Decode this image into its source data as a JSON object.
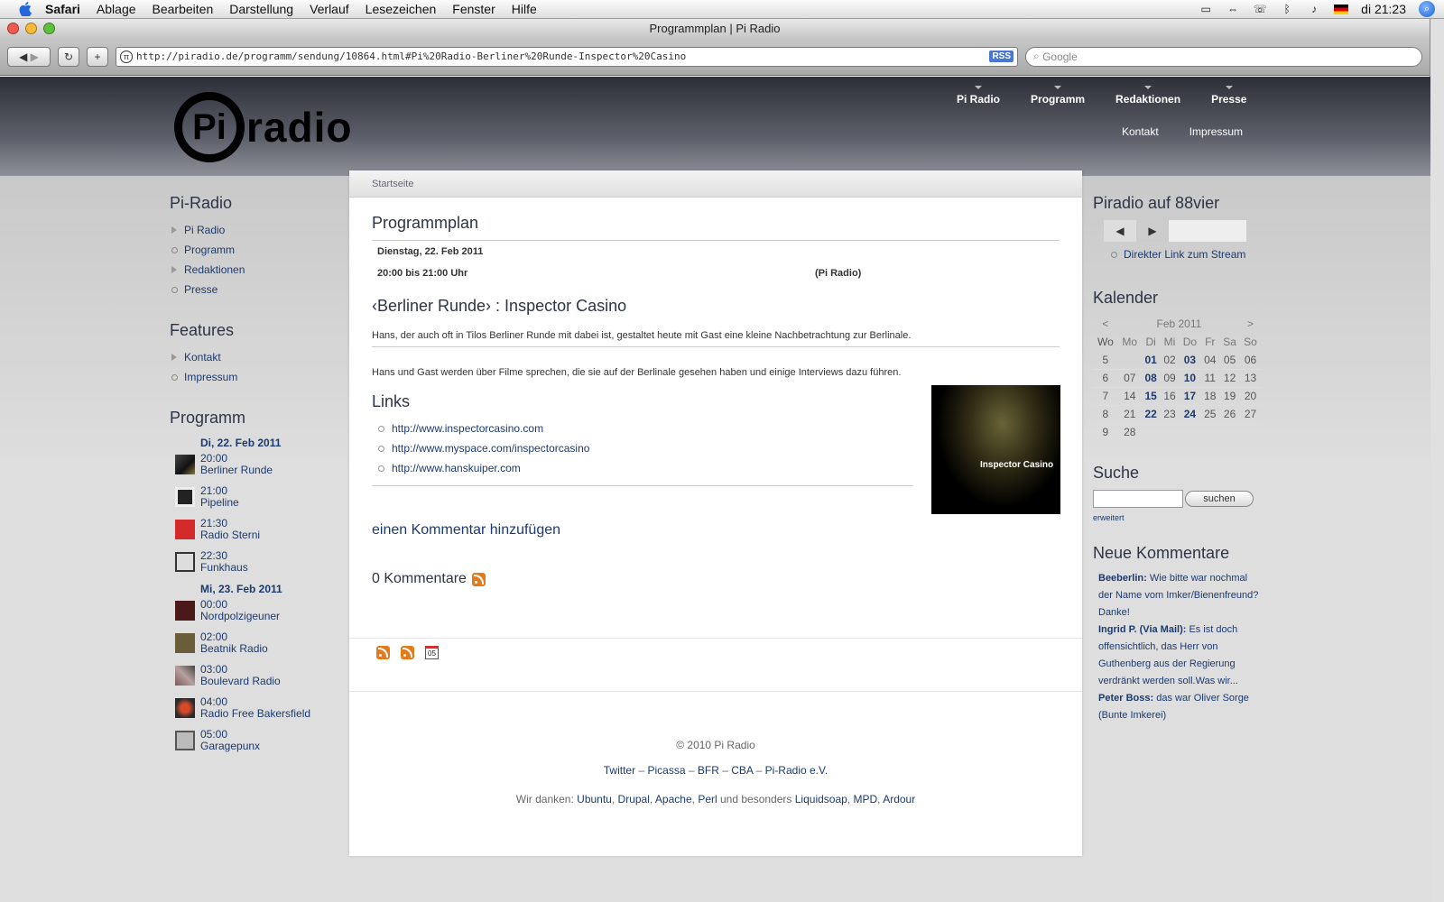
{
  "menubar": {
    "app": "Safari",
    "items": [
      "Ablage",
      "Bearbeiten",
      "Darstellung",
      "Verlauf",
      "Lesezeichen",
      "Fenster",
      "Hilfe"
    ],
    "clock": "di 21:23"
  },
  "browser": {
    "title": "Programmplan | Pi Radio",
    "url": "http://piradio.de/programm/sendung/10864.html#Pi%20Radio-Berliner%20Runde-Inspector%20Casino",
    "rss": "RSS",
    "search_placeholder": "Google"
  },
  "header": {
    "logo_pi": "Pi",
    "logo_word": "radio",
    "mainnav": [
      "Pi Radio",
      "Programm",
      "Redaktionen",
      "Presse"
    ],
    "subnav": [
      "Kontakt",
      "Impressum"
    ]
  },
  "left": {
    "pi_radio_title": "Pi-Radio",
    "pi_radio_items": [
      "Pi Radio",
      "Programm",
      "Redaktionen",
      "Presse"
    ],
    "features_title": "Features",
    "features_items": [
      "Kontakt",
      "Impressum"
    ],
    "programm_title": "Programm",
    "day1": "Di, 22. Feb 2011",
    "day1_items": [
      {
        "time": "20:00",
        "name": "Berliner Runde"
      },
      {
        "time": "21:00",
        "name": "Pipeline"
      },
      {
        "time": "21:30",
        "name": "Radio Sterni"
      },
      {
        "time": "22:30",
        "name": "Funkhaus"
      }
    ],
    "day2": "Mi, 23. Feb 2011",
    "day2_items": [
      {
        "time": "00:00",
        "name": "Nordpolzigeuner"
      },
      {
        "time": "02:00",
        "name": "Beatnik Radio"
      },
      {
        "time": "03:00",
        "name": "Boulevard Radio"
      },
      {
        "time": "04:00",
        "name": "Radio Free Bakersfield"
      },
      {
        "time": "05:00",
        "name": "Garagepunx"
      }
    ]
  },
  "content": {
    "breadcrumb": "Startseite",
    "page_title": "Programmplan",
    "date": "Dienstag, 22. Feb 2011",
    "time": "20:00 bis 21:00 Uhr",
    "station": "(Pi Radio)",
    "show_title": "‹Berliner Runde› : Inspector Casino",
    "intro": "Hans, der auch oft in Tilos Berliner Runde mit dabei ist, gestaltet heute mit Gast eine kleine Nachbetrachtung zur Berlinale.",
    "body": "Hans und Gast werden über Filme sprechen, die sie auf der Berlinale gesehen haben und einige Interviews dazu führen.",
    "cover_label": "Inspector Casino",
    "links_title": "Links",
    "links": [
      "http://www.inspectorcasino.com",
      "http://www.myspace.com/inspectorcasino",
      "http://www.hanskuiper.com"
    ],
    "add_comment": "einen Kommentar hinzufügen",
    "comments": "0 Kommentare",
    "cal_icon_text": "05"
  },
  "footer": {
    "copyright": "© 2010 Pi Radio",
    "links": [
      "Twitter",
      "Picassa",
      "BFR",
      "CBA",
      "Pi-Radio e.V."
    ],
    "link_sep": "–",
    "thanks_prefix": "Wir danken:",
    "thanks_and": "und besonders",
    "thanks_sep": ",",
    "thanks": [
      "Ubuntu",
      "Drupal",
      "Apache",
      "Perl"
    ],
    "thanks_special": [
      "Liquidsoap",
      "MPD",
      "Ardour"
    ]
  },
  "right": {
    "stream_title": "Piradio auf 88vier",
    "stream_link": "Direkter Link zum Stream",
    "calendar_title": "Kalender",
    "calendar": {
      "prev": "<",
      "month": "Feb 2011",
      "next": ">",
      "headers": [
        "Wo",
        "Mo",
        "Di",
        "Mi",
        "Do",
        "Fr",
        "Sa",
        "So"
      ],
      "weeks": [
        [
          "5",
          "",
          "01",
          "02",
          "03",
          "04",
          "05",
          "06"
        ],
        [
          "6",
          "07",
          "08",
          "09",
          "10",
          "11",
          "12",
          "13"
        ],
        [
          "7",
          "14",
          "15",
          "16",
          "17",
          "18",
          "19",
          "20"
        ],
        [
          "8",
          "21",
          "22",
          "23",
          "24",
          "25",
          "26",
          "27"
        ],
        [
          "9",
          "28",
          "",
          "",
          "",
          "",
          "",
          ""
        ]
      ],
      "bold": [
        "01",
        "03",
        "08",
        "10",
        "15",
        "17",
        "22",
        "24"
      ]
    },
    "search_title": "Suche",
    "search_button": "suchen",
    "advanced": "erweitert",
    "comments_title": "Neue Kommentare",
    "comments": [
      {
        "author": "Beeberlin",
        "text": "Wie bitte war nochmal der Name vom Imker/Bienenfreund? Danke!"
      },
      {
        "author": "Ingrid P. (Via Mail)",
        "text": "Es ist doch offensichtlich, das Herr von Guthenberg aus der Regierung verdränkt werden soll.Was wir..."
      },
      {
        "author": "Peter Boss",
        "text": "das war Oliver Sorge (Bunte Imkerei)"
      }
    ]
  }
}
